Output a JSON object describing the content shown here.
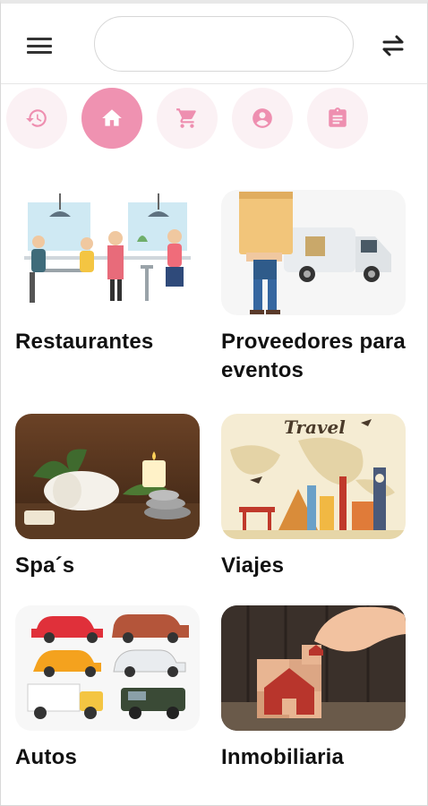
{
  "search": {
    "value": "",
    "placeholder": ""
  },
  "tabs": [
    {
      "icon": "history-icon",
      "active": false
    },
    {
      "icon": "home-icon",
      "active": true
    },
    {
      "icon": "cart-icon",
      "active": false
    },
    {
      "icon": "account-icon",
      "active": false
    },
    {
      "icon": "clipboard-icon",
      "active": false
    }
  ],
  "colors": {
    "accent": "#ef92b1",
    "accent_light": "#fbf1f4",
    "icon_pink": "#ee8fb0"
  },
  "categories": [
    {
      "label": "Restaurantes"
    },
    {
      "label": "Proveedores para eventos"
    },
    {
      "label": "Spa´s"
    },
    {
      "label": "Viajes",
      "image_text": "Travel"
    },
    {
      "label": "Autos"
    },
    {
      "label": "Inmobiliaria"
    }
  ]
}
